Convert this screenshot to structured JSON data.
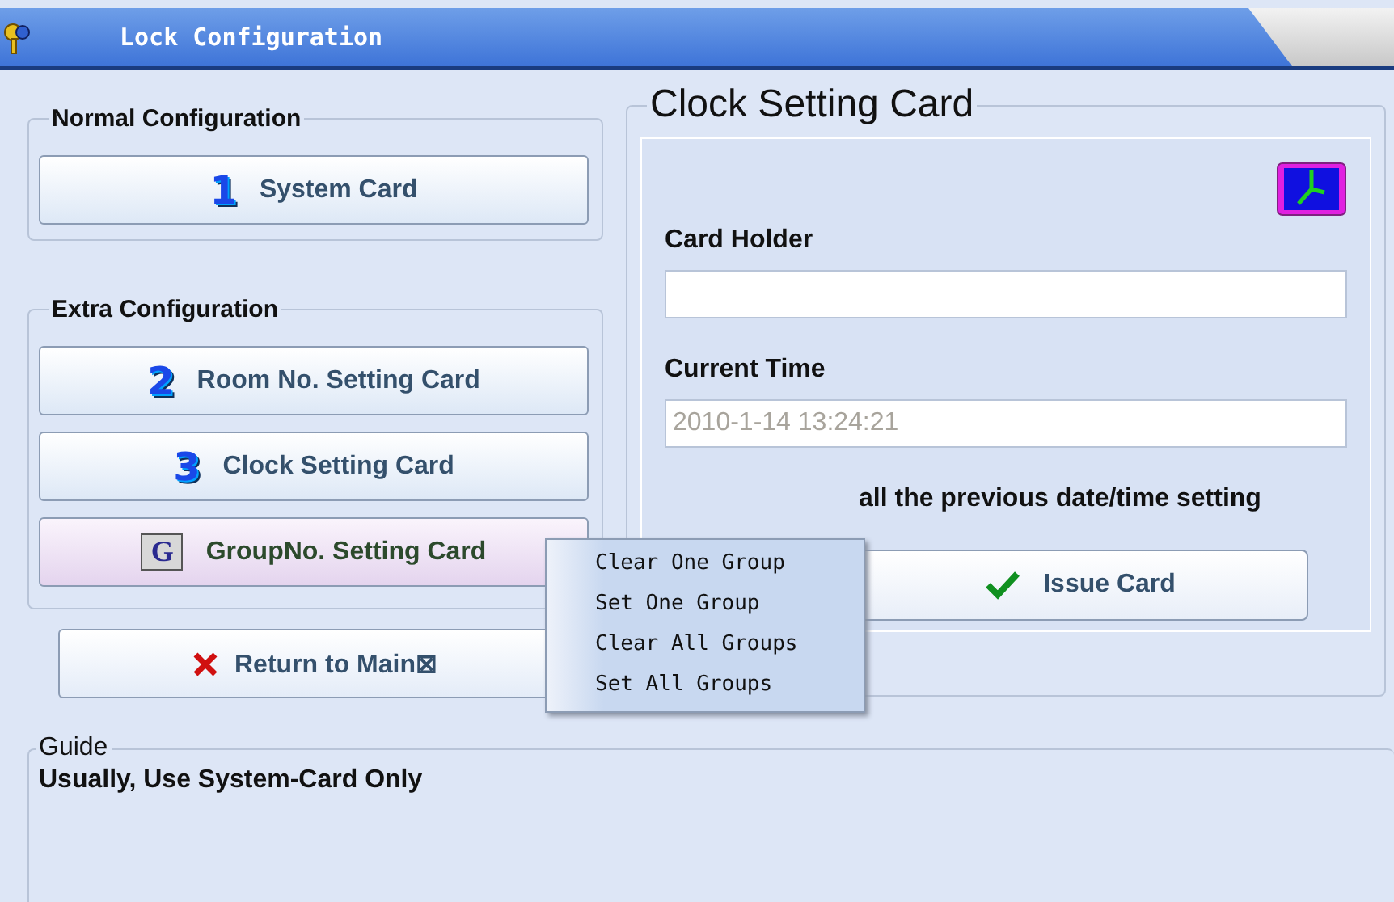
{
  "window": {
    "title": "Lock Configuration"
  },
  "normal_configuration": {
    "title": "Normal Configuration",
    "buttons": [
      {
        "badge": "1",
        "kind": "digit",
        "label": "System Card"
      }
    ]
  },
  "extra_configuration": {
    "title": "Extra Configuration",
    "buttons": [
      {
        "badge": "2",
        "kind": "digit",
        "label": "Room No. Setting Card"
      },
      {
        "badge": "3",
        "kind": "digit",
        "label": "Clock Setting Card"
      },
      {
        "badge": "G",
        "kind": "letter",
        "label": "GroupNo. Setting Card"
      }
    ]
  },
  "return_button": {
    "label": "Return to Main⊠"
  },
  "clock_card": {
    "title": "Clock Setting Card",
    "card_holder": {
      "label": "Card Holder"
    },
    "current_time": {
      "label": "Current Time",
      "value": "2010-1-14 13:24:21"
    },
    "note": "all the previous date/time setting",
    "issue_button": "Issue Card"
  },
  "context_menu": [
    "Clear One Group",
    "Set One Group",
    "Clear All Groups",
    "Set All Groups"
  ],
  "guide": {
    "title": "Guide",
    "text": "Usually, Use System-Card Only"
  }
}
